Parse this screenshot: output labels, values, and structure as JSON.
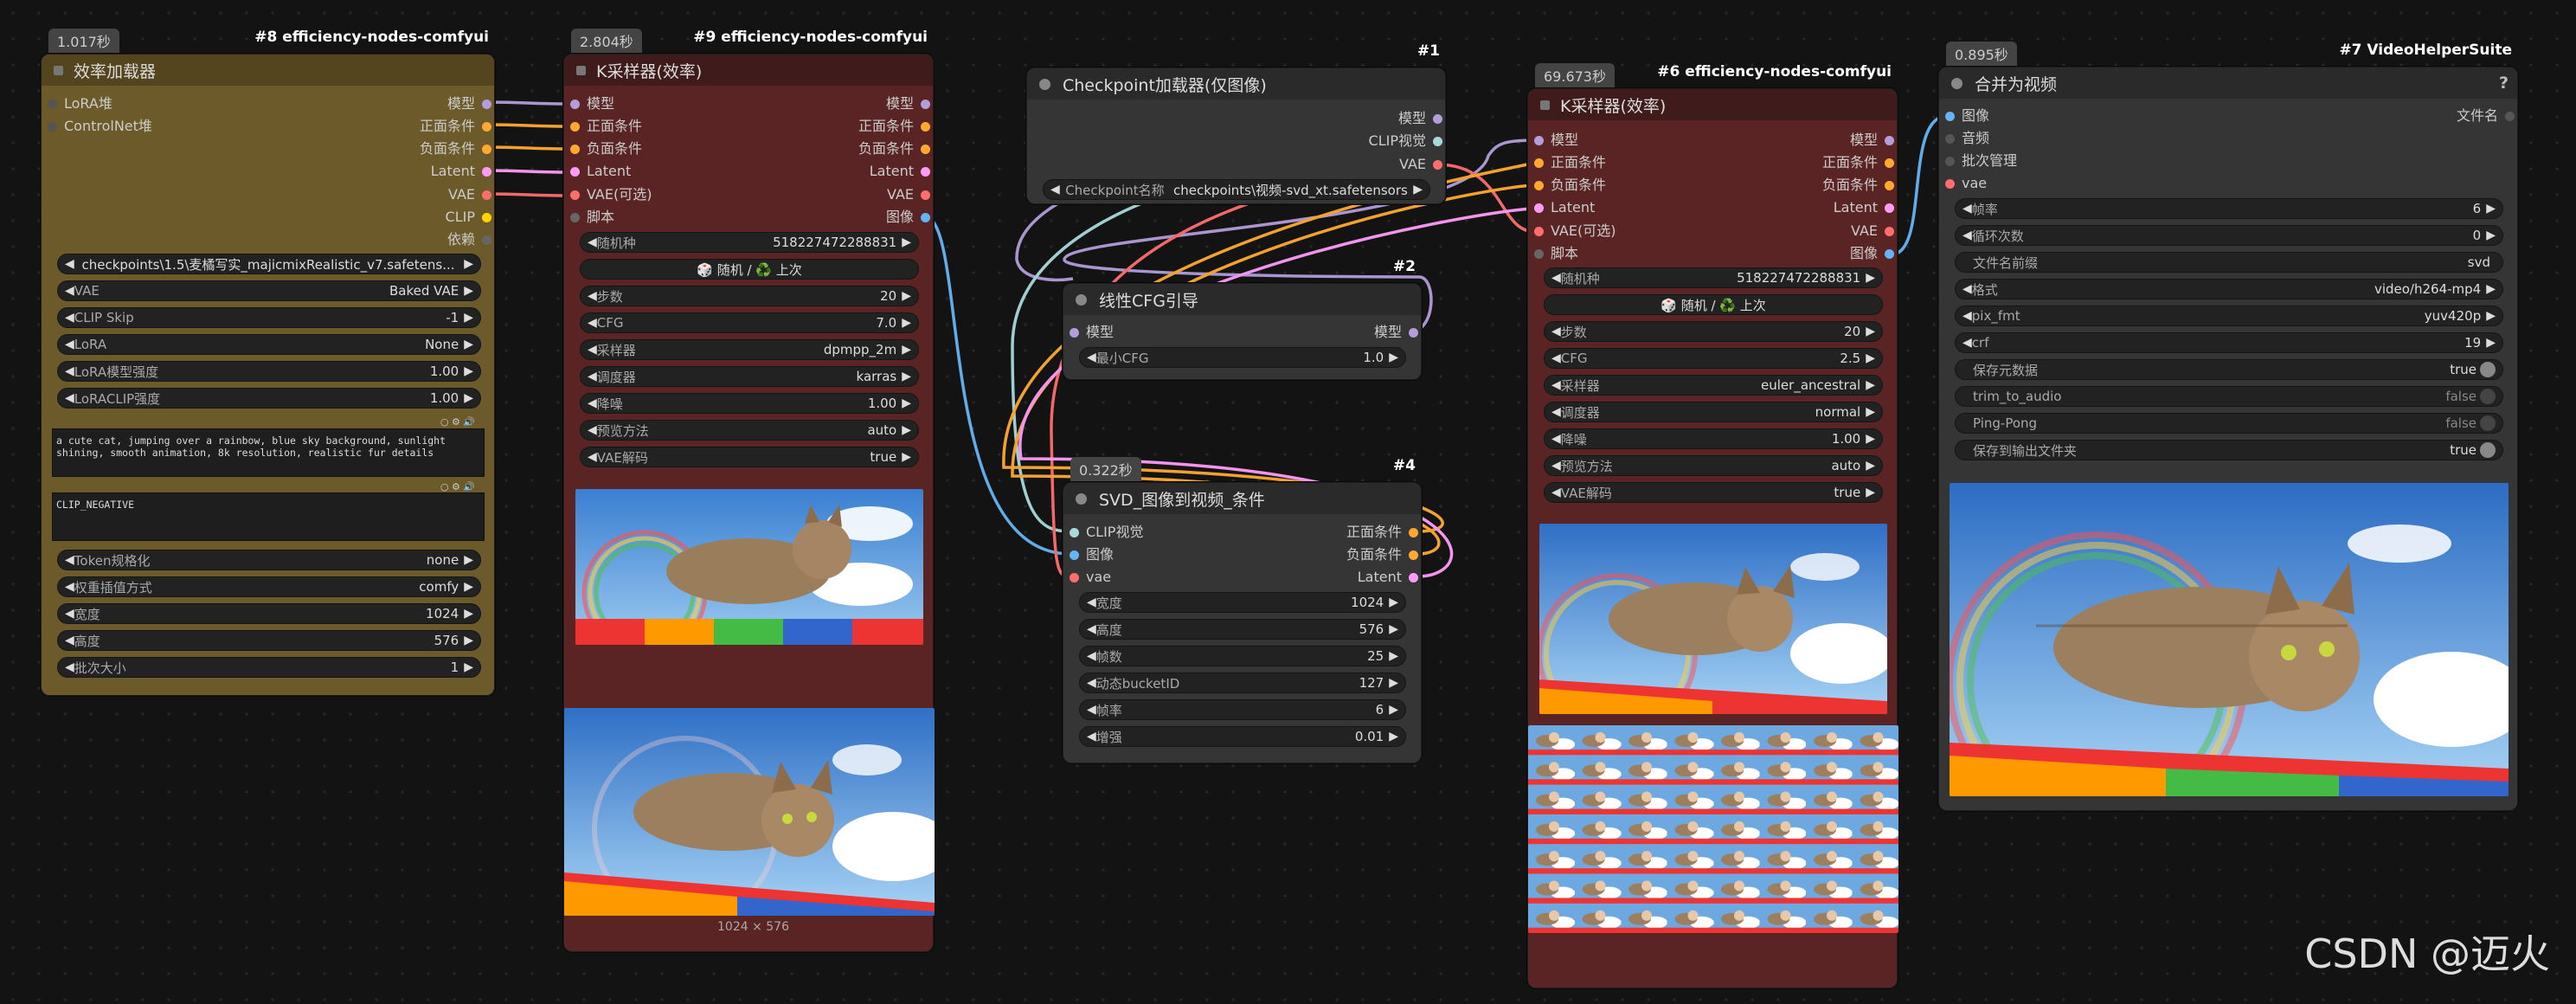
{
  "nodes": {
    "n8": {
      "tag": "#8 efficiency-nodes-comfyui",
      "time": "1.017秒",
      "title": "效率加载器",
      "inputs": [
        "LoRA堆",
        "ControlNet堆"
      ],
      "outputs": [
        "模型",
        "正面条件",
        "负面条件",
        "Latent",
        "VAE",
        "CLIP",
        "依赖"
      ],
      "widgets": [
        {
          "label": "",
          "value": "checkpoints\\1.5\\麦橘写实_majicmixRealistic_v7.safetens..."
        },
        {
          "label": "VAE",
          "value": "Baked VAE"
        },
        {
          "label": "CLIP Skip",
          "value": "-1"
        },
        {
          "label": "LoRA",
          "value": "None"
        },
        {
          "label": "LoRA模型强度",
          "value": "1.00"
        },
        {
          "label": "LoRACLIP强度",
          "value": "1.00"
        }
      ],
      "positive": "a cute cat, jumping over a rainbow, blue sky background, sunlight shining, smooth animation, 8k resolution, realistic fur details",
      "negative": "CLIP_NEGATIVE",
      "widgets2": [
        {
          "label": "Token规格化",
          "value": "none"
        },
        {
          "label": "权重插值方式",
          "value": "comfy"
        },
        {
          "label": "宽度",
          "value": "1024"
        },
        {
          "label": "高度",
          "value": "576"
        },
        {
          "label": "批次大小",
          "value": "1"
        }
      ]
    },
    "n9": {
      "tag": "#9 efficiency-nodes-comfyui",
      "time": "2.804秒",
      "title": "K采样器(效率)",
      "inputs": [
        "模型",
        "正面条件",
        "负面条件",
        "Latent",
        "VAE(可选)",
        "脚本"
      ],
      "outputs": [
        "模型",
        "正面条件",
        "负面条件",
        "Latent",
        "VAE",
        "图像"
      ],
      "seed": {
        "label": "随机种",
        "value": "518227472288831"
      },
      "random": "🎲 随机 / ♻️ 上次",
      "widgets": [
        {
          "label": "步数",
          "value": "20"
        },
        {
          "label": "CFG",
          "value": "7.0"
        },
        {
          "label": "采样器",
          "value": "dpmpp_2m"
        },
        {
          "label": "调度器",
          "value": "karras"
        },
        {
          "label": "降噪",
          "value": "1.00"
        },
        {
          "label": "预览方法",
          "value": "auto"
        },
        {
          "label": "VAE解码",
          "value": "true"
        }
      ],
      "caption": "1024 × 576"
    },
    "n1": {
      "tag": "#1",
      "title": "Checkpoint加载器(仅图像)",
      "outputs": [
        "模型",
        "CLIP视觉",
        "VAE"
      ],
      "widget": {
        "label": "Checkpoint名称",
        "value": "checkpoints\\视频-svd_xt.safetensors"
      }
    },
    "n2": {
      "tag": "#2",
      "title": "线性CFG引导",
      "inputs": [
        "模型"
      ],
      "outputs": [
        "模型"
      ],
      "widget": {
        "label": "最小CFG",
        "value": "1.0"
      }
    },
    "n4": {
      "tag": "#4",
      "time": "0.322秒",
      "title": "SVD_图像到视频_条件",
      "inputs": [
        "CLIP视觉",
        "图像",
        "vae"
      ],
      "outputs": [
        "正面条件",
        "负面条件",
        "Latent"
      ],
      "widgets": [
        {
          "label": "宽度",
          "value": "1024"
        },
        {
          "label": "高度",
          "value": "576"
        },
        {
          "label": "帧数",
          "value": "25"
        },
        {
          "label": "动态bucketID",
          "value": "127"
        },
        {
          "label": "帧率",
          "value": "6"
        },
        {
          "label": "增强",
          "value": "0.01"
        }
      ]
    },
    "n6": {
      "tag": "#6 efficiency-nodes-comfyui",
      "time": "69.673秒",
      "title": "K采样器(效率)",
      "inputs": [
        "模型",
        "正面条件",
        "负面条件",
        "Latent",
        "VAE(可选)",
        "脚本"
      ],
      "outputs": [
        "模型",
        "正面条件",
        "负面条件",
        "Latent",
        "VAE",
        "图像"
      ],
      "seed": {
        "label": "随机种",
        "value": "518227472288831"
      },
      "random": "🎲 随机 / ♻️ 上次",
      "widgets": [
        {
          "label": "步数",
          "value": "20"
        },
        {
          "label": "CFG",
          "value": "2.5"
        },
        {
          "label": "采样器",
          "value": "euler_ancestral"
        },
        {
          "label": "调度器",
          "value": "normal"
        },
        {
          "label": "降噪",
          "value": "1.00"
        },
        {
          "label": "预览方法",
          "value": "auto"
        },
        {
          "label": "VAE解码",
          "value": "true"
        }
      ]
    },
    "n7": {
      "tag": "#7 VideoHelperSuite",
      "time": "0.895秒",
      "title": "合并为视频",
      "help": "?",
      "inputs": [
        "图像",
        "音频",
        "批次管理",
        "vae"
      ],
      "outputs": [
        "文件名"
      ],
      "widgets": [
        {
          "label": "帧率",
          "value": "6",
          "arrows": true
        },
        {
          "label": "循环次数",
          "value": "0",
          "arrows": true
        },
        {
          "label": "文件名前缀",
          "value": "svd",
          "arrows": false
        },
        {
          "label": "格式",
          "value": "video/h264-mp4",
          "arrows": true
        },
        {
          "label": "pix_fmt",
          "value": "yuv420p",
          "arrows": true
        },
        {
          "label": "crf",
          "value": "19",
          "arrows": true
        }
      ],
      "toggles": [
        {
          "label": "保存元数据",
          "value": "true"
        },
        {
          "label": "trim_to_audio",
          "value": "false"
        },
        {
          "label": "Ping-Pong",
          "value": "false"
        },
        {
          "label": "保存到输出文件夹",
          "value": "true"
        }
      ]
    }
  },
  "watermark": "CSDN @迈火",
  "colors": {
    "model": "#b39ddb",
    "cond_pos": "#ffa931",
    "cond_neg": "#ffa931",
    "latent": "#ff9cf9",
    "vae": "#ff6e6e",
    "clip": "#ffd500",
    "image": "#64b5f6",
    "clip_vision": "#a8dadc"
  }
}
